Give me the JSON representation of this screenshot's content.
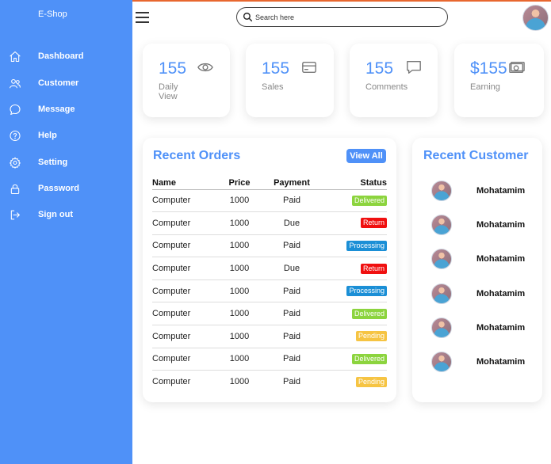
{
  "brand": "E-Shop",
  "sidebar": {
    "items": [
      {
        "label": "Dashboard",
        "icon": "home-icon"
      },
      {
        "label": "Customer",
        "icon": "users-icon"
      },
      {
        "label": "Message",
        "icon": "chat-icon"
      },
      {
        "label": "Help",
        "icon": "help-icon"
      },
      {
        "label": "Setting",
        "icon": "gear-icon"
      },
      {
        "label": "Password",
        "icon": "lock-icon"
      },
      {
        "label": "Sign out",
        "icon": "logout-icon"
      }
    ]
  },
  "header": {
    "search_placeholder": "Search here"
  },
  "cards": [
    {
      "value": "155",
      "label": "Daily View",
      "icon": "eye-icon"
    },
    {
      "value": "155",
      "label": "Sales",
      "icon": "card-icon"
    },
    {
      "value": "155",
      "label": "Comments",
      "icon": "comment-icon"
    },
    {
      "value": "$155",
      "label": "Earning",
      "icon": "cash-icon"
    }
  ],
  "orders": {
    "title": "Recent Orders",
    "view_all": "View All",
    "columns": [
      "Name",
      "Price",
      "Payment",
      "Status"
    ],
    "rows": [
      {
        "name": "Computer",
        "price": "1000",
        "payment": "Paid",
        "status": "Delivered"
      },
      {
        "name": "Computer",
        "price": "1000",
        "payment": "Due",
        "status": "Return"
      },
      {
        "name": "Computer",
        "price": "1000",
        "payment": "Paid",
        "status": "Processing"
      },
      {
        "name": "Computer",
        "price": "1000",
        "payment": "Due",
        "status": "Return"
      },
      {
        "name": "Computer",
        "price": "1000",
        "payment": "Paid",
        "status": "Processing"
      },
      {
        "name": "Computer",
        "price": "1000",
        "payment": "Paid",
        "status": "Delivered"
      },
      {
        "name": "Computer",
        "price": "1000",
        "payment": "Paid",
        "status": "Pending"
      },
      {
        "name": "Computer",
        "price": "1000",
        "payment": "Paid",
        "status": "Delivered"
      },
      {
        "name": "Computer",
        "price": "1000",
        "payment": "Paid",
        "status": "Pending"
      }
    ]
  },
  "status_colors": {
    "Delivered": "#8cd43e",
    "Return": "#f01010",
    "Processing": "#1b8fd6",
    "Pending": "#f6c443"
  },
  "customers": {
    "title": "Recent Customer",
    "items": [
      {
        "name": "Mohatamim"
      },
      {
        "name": "Mohatamim"
      },
      {
        "name": "Mohatamim"
      },
      {
        "name": "Mohatamim"
      },
      {
        "name": "Mohatamim"
      },
      {
        "name": "Mohatamim"
      }
    ]
  },
  "colors": {
    "accent": "#4f91f8",
    "top_stripe": "#e8672f"
  }
}
